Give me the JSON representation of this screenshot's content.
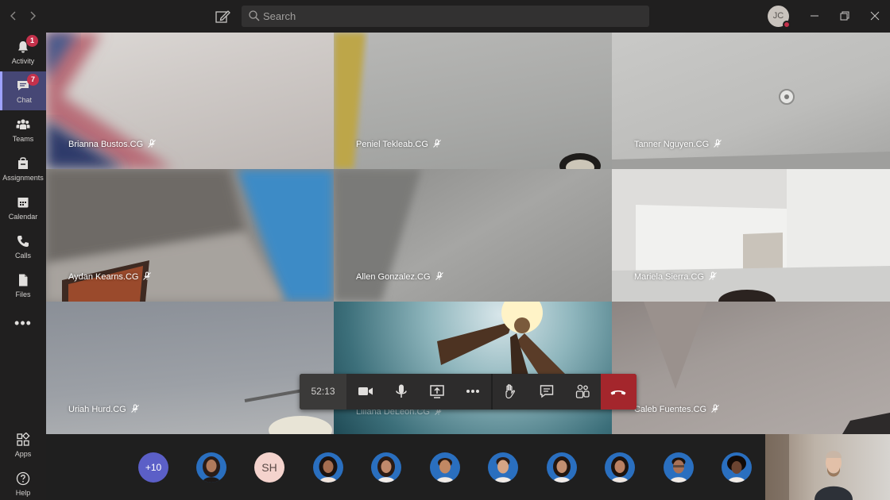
{
  "titlebar": {
    "back_icon": "chevron-left-icon",
    "forward_icon": "chevron-right-icon",
    "compose_icon": "compose-icon",
    "search_placeholder": "Search",
    "user_initials": "JC",
    "user_status_color": "#c4314b"
  },
  "rail": {
    "items": [
      {
        "label": "Activity",
        "icon": "bell-icon",
        "badge": "1"
      },
      {
        "label": "Chat",
        "icon": "chat-icon",
        "badge": "7",
        "active": true
      },
      {
        "label": "Teams",
        "icon": "teams-icon"
      },
      {
        "label": "Assignments",
        "icon": "assignments-icon"
      },
      {
        "label": "Calendar",
        "icon": "calendar-icon"
      },
      {
        "label": "Calls",
        "icon": "phone-icon"
      },
      {
        "label": "Files",
        "icon": "file-icon"
      }
    ],
    "more": "•••",
    "bottom": [
      {
        "label": "Apps",
        "icon": "apps-icon"
      },
      {
        "label": "Help",
        "icon": "help-icon"
      }
    ]
  },
  "participants": [
    {
      "name": "Brianna Bustos.CG"
    },
    {
      "name": "Peniel Tekleab.CG"
    },
    {
      "name": "Tanner Nguyen.CG"
    },
    {
      "name": "Aydan Kearns.CG"
    },
    {
      "name": "Allen Gonzalez.CG"
    },
    {
      "name": "Mariela Sierra.CG"
    },
    {
      "name": "Uriah Hurd.CG"
    },
    {
      "name": "Liliana DeLeon.CG"
    },
    {
      "name": "Caleb Fuentes.CG"
    }
  ],
  "controls": {
    "timer": "52:13",
    "camera_icon": "video-camera-icon",
    "mic_icon": "microphone-icon",
    "share_icon": "share-screen-icon",
    "more_icon": "more-options-icon",
    "raise_hand_icon": "raise-hand-icon",
    "chat_icon": "conversation-icon",
    "participants_icon": "participants-icon",
    "hangup_icon": "hang-up-icon",
    "hangup_color": "#a4262c"
  },
  "roster": {
    "overflow_count": "+10",
    "initials": "SH"
  },
  "accent": "#464775"
}
